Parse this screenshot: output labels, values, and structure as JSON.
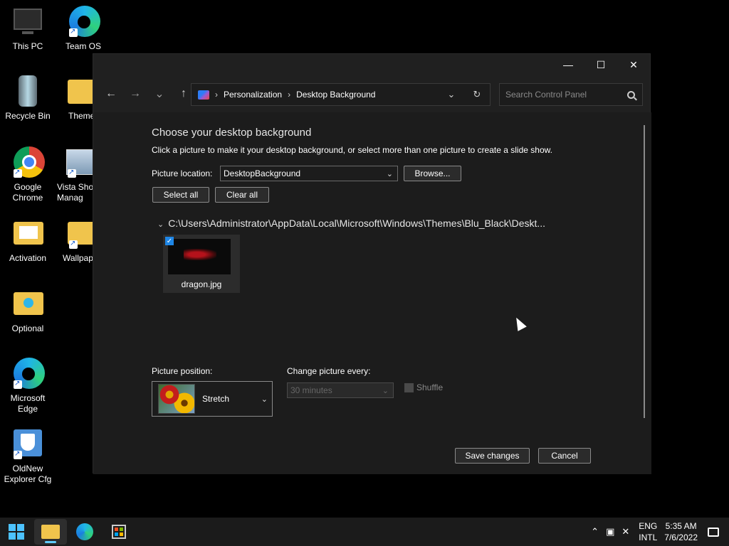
{
  "desktop": {
    "icons": [
      {
        "label": "This PC"
      },
      {
        "label": "Team OS"
      },
      {
        "label": "Recycle Bin"
      },
      {
        "label": "Theme"
      },
      {
        "label": "Google Chrome"
      },
      {
        "label": "Vista Sho Manag"
      },
      {
        "label": "Activation"
      },
      {
        "label": "Wallpap"
      },
      {
        "label": "Optional"
      },
      {
        "label": "Microsoft Edge"
      },
      {
        "label": "OldNew Explorer Cfg"
      }
    ]
  },
  "window": {
    "controls": {
      "minimize": "—",
      "maximize": "☐",
      "close": "✕"
    },
    "nav": {
      "back": "←",
      "forward": "→",
      "recent": "⌄",
      "up": "↑"
    },
    "breadcrumb": [
      "Personalization",
      "Desktop Background"
    ],
    "breadcrumb_sep": "›",
    "address_dropdown": "⌄",
    "refresh": "↻",
    "search_placeholder": "Search Control Panel"
  },
  "content": {
    "title": "Choose your desktop background",
    "subtitle": "Click a picture to make it your desktop background, or select more than one picture to create a slide show.",
    "picture_location_label": "Picture location:",
    "picture_location_value": "DesktopBackground",
    "browse_label": "Browse...",
    "select_all_label": "Select all",
    "clear_all_label": "Clear all",
    "folder_path": "C:\\Users\\Administrator\\AppData\\Local\\Microsoft\\Windows\\Themes\\Blu_Black\\Deskt...",
    "thumbnail": {
      "name": "dragon.jpg",
      "checked": true
    },
    "picture_position_label": "Picture position:",
    "picture_position_value": "Stretch",
    "change_every_label": "Change picture every:",
    "change_every_value": "30 minutes",
    "shuffle_label": "Shuffle",
    "save_label": "Save changes",
    "cancel_label": "Cancel"
  },
  "taskbar": {
    "lang_line1": "ENG",
    "lang_line2": "INTL",
    "time": "5:35 AM",
    "date": "7/6/2022"
  },
  "colors": {
    "accent": "#1e86e6",
    "window_bg": "#1c1c1c",
    "taskbar_bg": "#1b1b1b"
  }
}
